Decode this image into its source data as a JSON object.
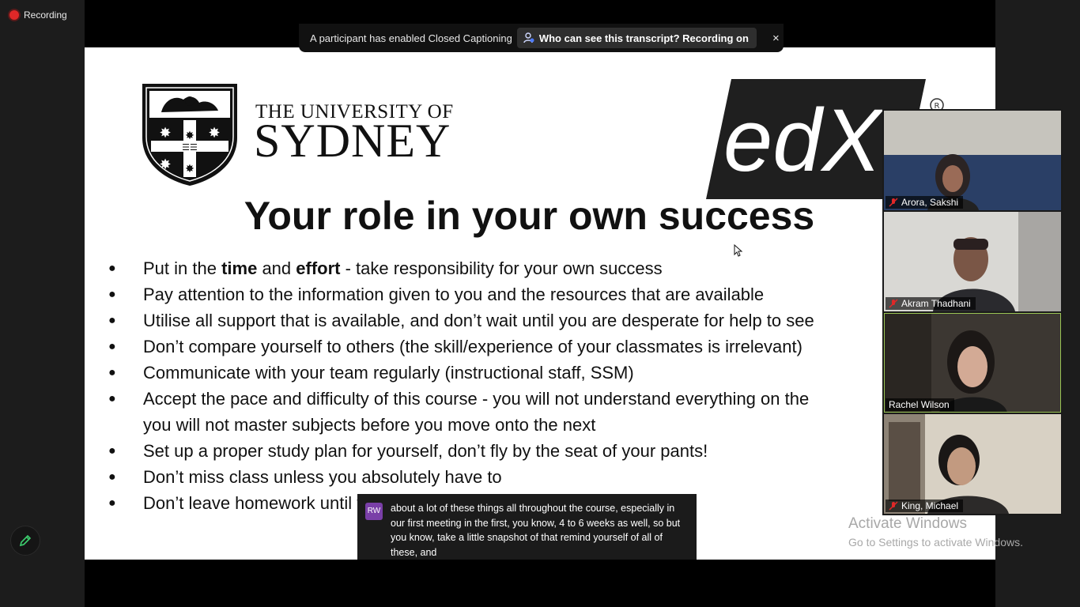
{
  "recording": {
    "label": "Recording"
  },
  "cc_bar": {
    "message": "A participant has enabled Closed Captioning",
    "pill_label": "Who can see this transcript? Recording on",
    "close_glyph": "×"
  },
  "slide": {
    "university_line1": "THE UNIVERSITY OF",
    "university_line2": "SYDNEY",
    "edx_logo": "edX",
    "title": "Your role in your own success",
    "bullets": [
      {
        "pre": "Put in the ",
        "b1": "time",
        "mid": " and ",
        "b2": "effort",
        "post": " - take responsibility for your own success"
      },
      {
        "text": "Pay attention to the information given to you and the resources that are available"
      },
      {
        "text": "Utilise all support that is available, and don’t wait until you are desperate for help to see"
      },
      {
        "text": "Don’t compare yourself to others (the skill/experience of your classmates is irrelevant)"
      },
      {
        "text": "Communicate with your team regularly (instructional staff, SSM)"
      },
      {
        "text": "Accept the pace and difficulty of this course - you will not understand everything on the"
      },
      {
        "text": "you will not master subjects before you move onto the next"
      },
      {
        "text": "Set up a proper study plan for yourself, don’t fly by the seat of your pants!"
      },
      {
        "text": "Don’t miss class unless you absolutely have to"
      },
      {
        "text": "Don’t leave homework until the last second"
      }
    ]
  },
  "caption": {
    "avatar_initials": "RW",
    "text": "about a lot of these things all throughout the course, especially in our first meeting in the first, you know, 4 to 6 weeks as well, so but you know, take a little snapshot of that remind yourself of all of these, and"
  },
  "watermark": {
    "line1": "Activate Windows",
    "line2": "Go to Settings to activate Windows."
  },
  "participants": [
    {
      "name": "Arora, Sakshi",
      "muted": true,
      "active": false
    },
    {
      "name": "Akram Thadhani",
      "muted": true,
      "active": false
    },
    {
      "name": "Rachel Wilson",
      "muted": false,
      "active": true
    },
    {
      "name": "King, Michael",
      "muted": true,
      "active": false
    }
  ],
  "colors": {
    "recording": "#e02828",
    "active_speaker": "#9ac455",
    "mute": "#e02828",
    "caption_avatar": "#7a3fa8"
  }
}
